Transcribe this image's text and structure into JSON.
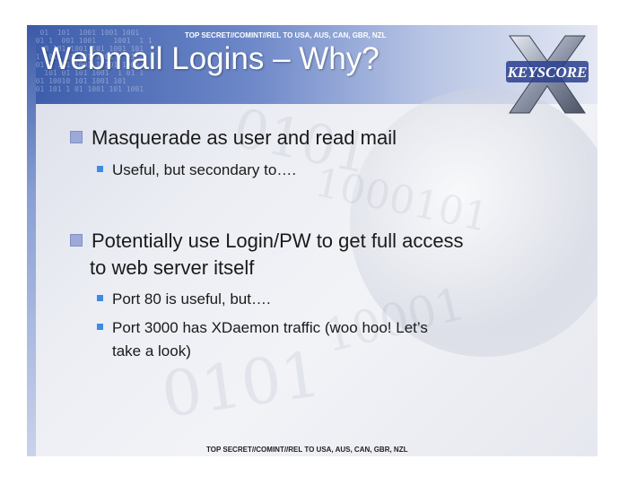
{
  "classification_banner": "TOP SECRET//COMINT//REL TO USA, AUS, CAN, GBR, NZL",
  "title": "Webmail Logins – Why?",
  "logo": {
    "text": "KEYSCORE",
    "icon": "keyscore-x-logo"
  },
  "bullets": [
    {
      "text": "Masquerade as user and read mail",
      "sub": [
        "Useful, but secondary to…."
      ]
    },
    {
      "text_line1": "Potentially use Login/PW to get full access",
      "text_line2": "to web server itself",
      "sub": [
        "Port 80 is useful, but….",
        "Port 3000 has XDaemon traffic (woo hoo! Let’s",
        "take a look)"
      ]
    }
  ],
  "colors": {
    "title_band": "#3b5cab",
    "bullet_primary": "#9da9d6",
    "bullet_secondary": "#3d8ae8"
  }
}
